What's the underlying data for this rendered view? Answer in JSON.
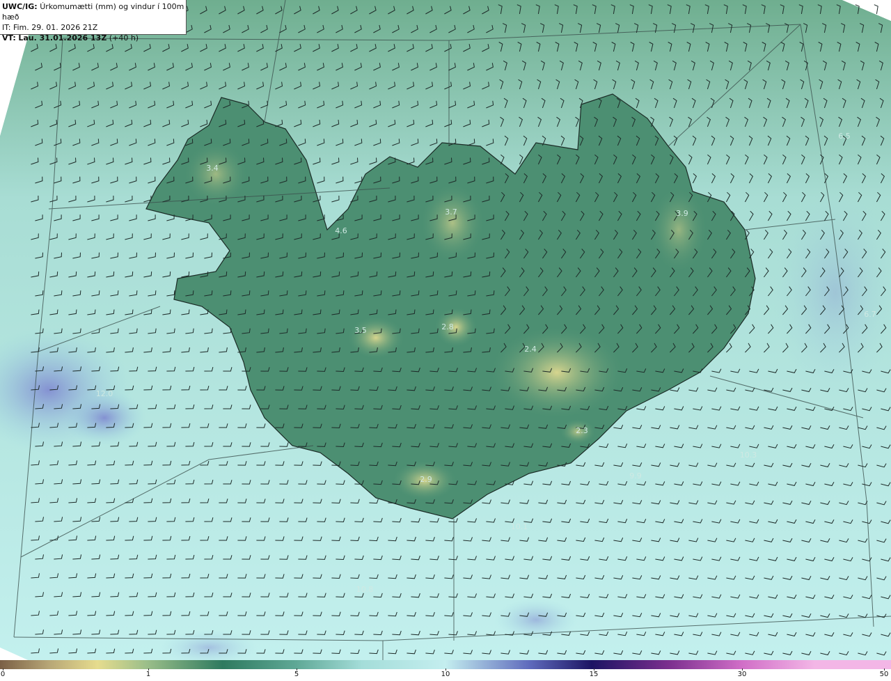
{
  "header": {
    "product": "UWC/IG:",
    "title": "Úrkomumætti (mm) og vindur í 100m hæð",
    "issue_time": "IT: Fim. 29. 01. 2026 21Z",
    "valid_prefix": "VT:",
    "valid_time": "Lau. 31.01.2026 13Z",
    "lead": "(+40 h)"
  },
  "map_labels": [
    {
      "text": "3.4"
    },
    {
      "text": "4.6"
    },
    {
      "text": "3.7"
    },
    {
      "text": "3.9"
    },
    {
      "text": "3.5"
    },
    {
      "text": "2.8"
    },
    {
      "text": "2.4"
    },
    {
      "text": "2.3"
    },
    {
      "text": "2.9"
    },
    {
      "text": "6.5"
    },
    {
      "text": "10.3"
    },
    {
      "text": "9.9"
    },
    {
      "text": "10.1"
    },
    {
      "text": "10.8"
    },
    {
      "text": "12.0"
    },
    {
      "text": "6.7"
    }
  ],
  "colorbar": {
    "ticks": [
      "0",
      "1",
      "5",
      "10",
      "15",
      "30",
      "50"
    ],
    "colors": [
      "#7a5f45",
      "#b7a676",
      "#e6dc8e",
      "#9cbf8a",
      "#2e7a5f",
      "#5fa896",
      "#a4ddd9",
      "#c4eeef",
      "#5f6bbd",
      "#1c1463",
      "#7b2f8e",
      "#d06ec7",
      "#f3b6e6"
    ]
  },
  "style": {
    "land_low": "#c7c98a",
    "land_mid": "#4e9475",
    "land_high": "#2d6e57",
    "sea": "#b7ebe8",
    "sea_wet": "#9ecfe0",
    "precip_blue": "#8a96d4"
  }
}
